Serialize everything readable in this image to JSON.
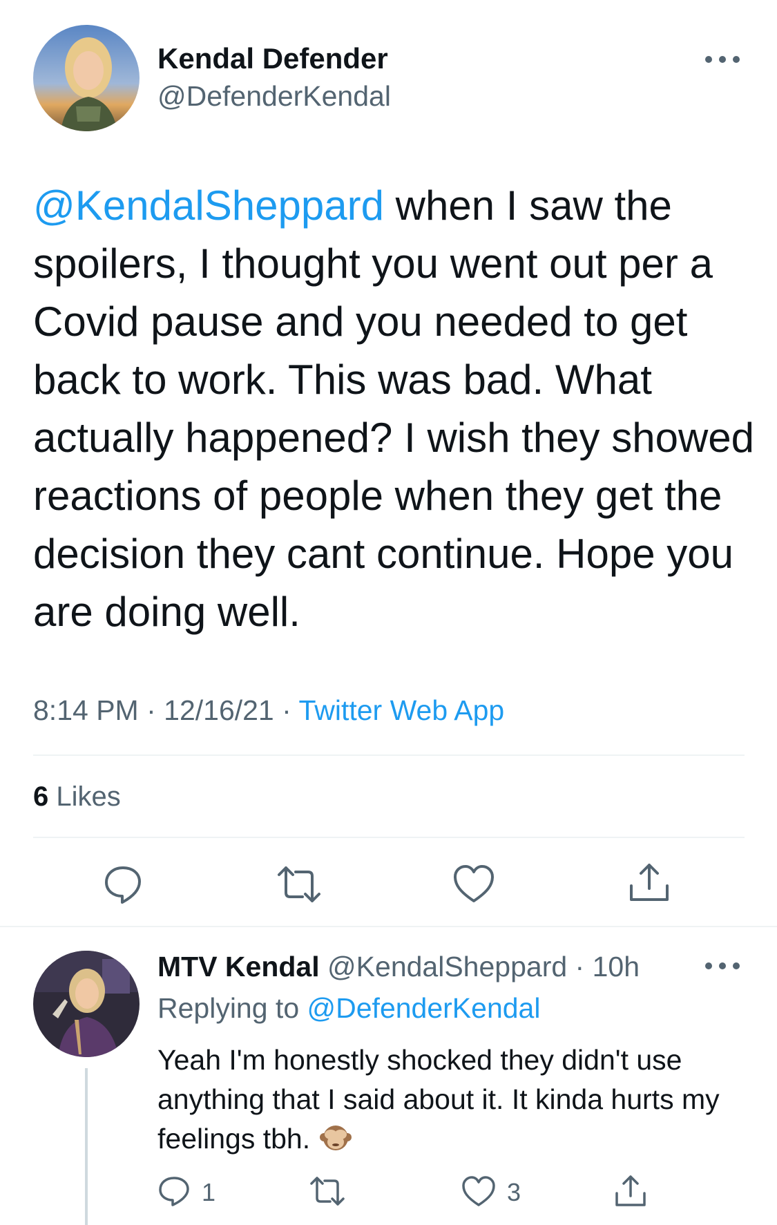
{
  "tweet": {
    "author": {
      "name": "Kendal Defender",
      "handle": "@DefenderKendal"
    },
    "mention": "@KendalSheppard",
    "text": " when I saw the spoilers, I thought you went out per a Covid pause and you needed to get back to work. This was bad. What actually happened? I wish they showed reactions of people when they get the decision they cant continue. Hope you are doing well.",
    "time": "8:14 PM",
    "separator": " · ",
    "date": "12/16/21",
    "source": "Twitter Web App",
    "likes_count": "6",
    "likes_label": " Likes"
  },
  "reply": {
    "author": {
      "name": "MTV Kendal",
      "handle": "@KendalSheppard",
      "time": "10h"
    },
    "separator": " · ",
    "replying_label": "Replying to ",
    "replying_to": "@DefenderKendal",
    "text": "Yeah I'm honestly shocked they didn't use anything that I said about it. It kinda hurts my feelings tbh.",
    "reply_count": "1",
    "like_count": "3"
  },
  "colors": {
    "accent": "#1d9bf0",
    "secondary_text": "#536471",
    "divider": "#eff3f4"
  },
  "icons": [
    "more-icon",
    "reply-icon",
    "retweet-icon",
    "like-icon",
    "share-icon",
    "see-no-evil-monkey-emoji"
  ]
}
